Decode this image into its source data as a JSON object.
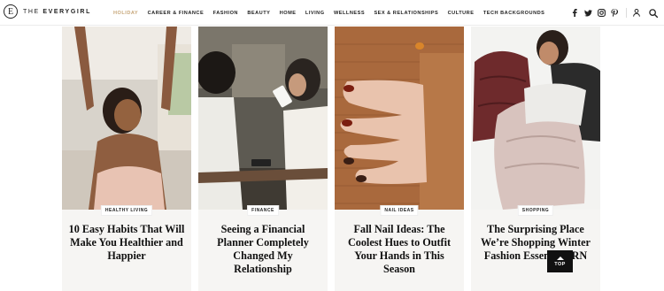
{
  "brand": {
    "mark": "E",
    "name_prefix": "THE ",
    "name_main": "EVERYGIRL"
  },
  "nav": {
    "items": [
      {
        "label": "HOLIDAY",
        "active": true
      },
      {
        "label": "CAREER & FINANCE"
      },
      {
        "label": "FASHION"
      },
      {
        "label": "BEAUTY"
      },
      {
        "label": "HOME"
      },
      {
        "label": "LIVING"
      },
      {
        "label": "WELLNESS"
      },
      {
        "label": "SEX & RELATIONSHIPS"
      },
      {
        "label": "CULTURE"
      },
      {
        "label": "TECH BACKGROUNDS"
      }
    ],
    "active_color": "#c7a77a"
  },
  "social": [
    "facebook-icon",
    "twitter-icon",
    "instagram-icon",
    "pinterest-icon"
  ],
  "tools": [
    "user-icon",
    "search-icon"
  ],
  "cards": [
    {
      "category": "HEALTHY LIVING",
      "title": "10 Easy Habits That Will Make You Healthier and Happier"
    },
    {
      "category": "FINANCE",
      "title": "Seeing a Financial Planner Completely Changed My Relationship"
    },
    {
      "category": "NAIL IDEAS",
      "title": "Fall Nail Ideas: The Coolest Hues to Outfit Your Hands in This Season"
    },
    {
      "category": "SHOPPING",
      "title": "The Surprising Place We’re Shopping Winter Fashion Essentials RN"
    }
  ],
  "back_to_top": {
    "label": "TOP"
  }
}
